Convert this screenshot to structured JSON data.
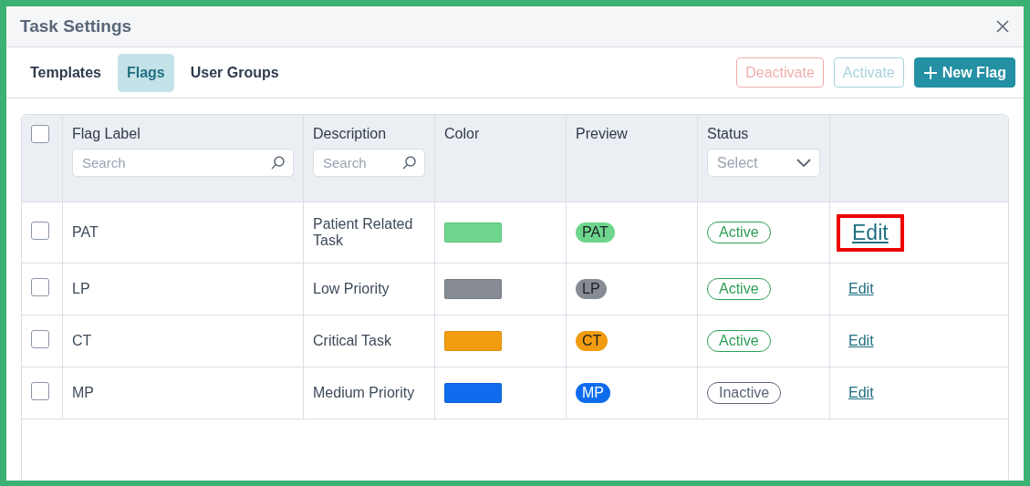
{
  "window": {
    "title": "Task Settings"
  },
  "tabs": [
    {
      "label": "Templates",
      "selected": false
    },
    {
      "label": "Flags",
      "selected": true
    },
    {
      "label": "User Groups",
      "selected": false
    }
  ],
  "actions": [
    {
      "label": "Deactivate",
      "kind": "danger",
      "disabled": true
    },
    {
      "label": "Activate",
      "kind": "primary",
      "disabled": true
    },
    {
      "label": "New Flag",
      "kind": "add",
      "disabled": false
    }
  ],
  "table": {
    "columns": [
      {
        "label": "Flag Label",
        "filter": {
          "kind": "search",
          "placeholder": "Search"
        }
      },
      {
        "label": "Description",
        "filter": {
          "kind": "search",
          "placeholder": "Search"
        }
      },
      {
        "label": "Color"
      },
      {
        "label": "Preview"
      },
      {
        "label": "Status",
        "filter": {
          "kind": "select",
          "placeholder": "Select"
        }
      }
    ],
    "select_all": {
      "checked": false
    },
    "rows": [
      {
        "label": "PAT",
        "description": "Patient Related Task",
        "color": "#6dd68c",
        "preview": "PAT",
        "status": "Active",
        "active": true,
        "checked": false,
        "edit": {
          "label": "Edit",
          "highlighted": true
        }
      },
      {
        "label": "LP",
        "description": "Low Priority",
        "color": "#868b94",
        "preview": "LP",
        "status": "Active",
        "active": true,
        "checked": false,
        "edit": {
          "label": "Edit",
          "highlighted": false
        }
      },
      {
        "label": "CT",
        "description": "Critical Task",
        "color": "#f29c10",
        "preview": "CT",
        "status": "Active",
        "active": true,
        "checked": false,
        "edit": {
          "label": "Edit",
          "highlighted": false
        }
      },
      {
        "label": "MP",
        "description": "Medium Priority",
        "color": "#0f6ded",
        "preview": "MP",
        "status": "Inactive",
        "active": false,
        "checked": false,
        "edit": {
          "label": "Edit",
          "highlighted": false
        }
      }
    ]
  }
}
